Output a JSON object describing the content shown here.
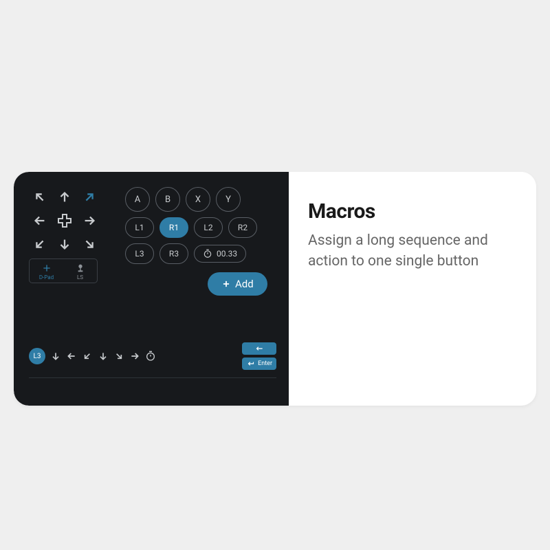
{
  "title": "Macros",
  "description": "Assign a long sequence and action to one single button",
  "colors": {
    "accent": "#2f7da6",
    "panel": "#17191c"
  },
  "dpad": {
    "modes": [
      {
        "id": "dpad",
        "label": "D-Pad",
        "active": true
      },
      {
        "id": "ls",
        "label": "LS",
        "active": false
      }
    ],
    "arrows": [
      "nw",
      "n",
      "ne",
      "w",
      "center",
      "e",
      "sw",
      "s",
      "se"
    ],
    "selected": "ne"
  },
  "face_buttons": [
    "A",
    "B",
    "X",
    "Y"
  ],
  "shoulder_row1": [
    "L1",
    "R1",
    "L2",
    "R2"
  ],
  "shoulder_row1_active": "R1",
  "shoulder_row2": [
    "L3",
    "R3"
  ],
  "timer_value": "00.33",
  "add_label": "Add",
  "sequence": {
    "trigger": "L3",
    "steps": [
      "s",
      "w",
      "sw",
      "s",
      "se",
      "e",
      "timer"
    ]
  },
  "action_keys": [
    {
      "id": "backspace",
      "label": ""
    },
    {
      "id": "enter",
      "label": "Enter"
    }
  ]
}
